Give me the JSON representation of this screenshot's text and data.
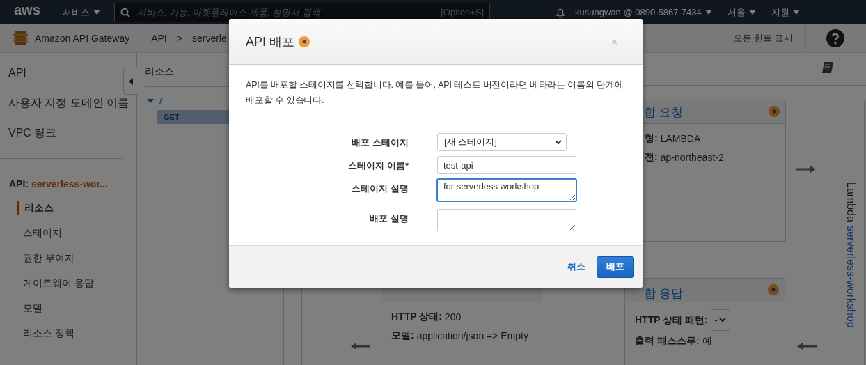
{
  "top_nav": {
    "logo": "aws",
    "services": "서비스",
    "search": {
      "placeholder": "서비스, 기능, 마켓플레이스 제품, 설명서 검색",
      "shortcut": "[Option+S]"
    },
    "account": "kusungwan @ 0890-5867-7434",
    "region": "서울",
    "support": "지원"
  },
  "service_bar": {
    "product": "Amazon API Gateway",
    "breadcrumb": [
      "API",
      "serverle"
    ],
    "separator": ">",
    "hints_button": "모든 힌트 표시"
  },
  "sidebar": {
    "top_items": [
      {
        "label": "API",
        "selected": false
      },
      {
        "label": "사용자 지정 도메인 이름",
        "selected": false
      },
      {
        "label": "VPC 링크",
        "selected": false
      }
    ],
    "api_label": "API:",
    "api_name": "serverless-wor...",
    "items": [
      {
        "label": "리소스",
        "selected": true
      },
      {
        "label": "스테이지",
        "selected": false
      },
      {
        "label": "권한 부여자",
        "selected": false
      },
      {
        "label": "게이트웨이 응답",
        "selected": false
      },
      {
        "label": "모델",
        "selected": false
      },
      {
        "label": "리소스 정책",
        "selected": false
      }
    ]
  },
  "resources": {
    "title": "리소스",
    "tree": [
      {
        "label": "/",
        "expanded": true,
        "children": [
          {
            "label": "GET",
            "selected": true
          }
        ]
      }
    ]
  },
  "flow": {
    "integration_request": {
      "title": "합 요청",
      "rows": [
        "**형:** LAMBDA",
        "**전:** ap-northeast-2"
      ]
    },
    "method_response": {
      "rows": [
        "**HTTP 상태:** 200",
        "**모델:** application/json => Empty"
      ]
    },
    "integration_response": {
      "title": "합 응답",
      "pattern_label": "HTTP 상태 패턴:",
      "pattern_value": "-",
      "rows": [
        "**출력 패스스루:** 예"
      ]
    },
    "lambda": {
      "label": "Lambda",
      "function": "serverless-workshop"
    }
  },
  "dialog": {
    "title": "API 배포",
    "close": "×",
    "description": "API를 배포할 스테이지를 선택합니다. 예를 들어, API 테스트 버전이라면 베타라는 이름의 단계에 배포할 수 있습니다.",
    "fields": [
      {
        "kind": "select",
        "label": "배포 스테이지",
        "value": "[새 스테이지]",
        "focused": false
      },
      {
        "kind": "input",
        "label": "스테이지 이름*",
        "value": "test-api",
        "focused": false
      },
      {
        "kind": "textarea",
        "label": "스테이지 설명",
        "value": "for serverless workshop",
        "focused": true
      },
      {
        "kind": "textarea",
        "label": "배포 설명",
        "focused": false
      }
    ],
    "cancel": "취소",
    "submit": "배포"
  }
}
